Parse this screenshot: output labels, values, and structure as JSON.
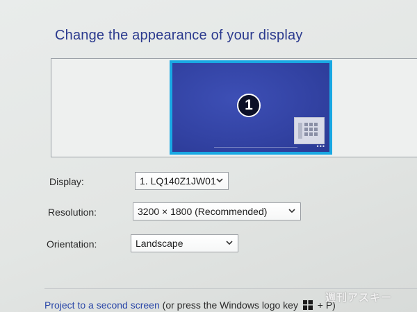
{
  "page": {
    "heading": "Change the appearance of your display"
  },
  "preview": {
    "monitor_number": "1",
    "accent_color": "#19a8e3",
    "screen_color": "#3343a4"
  },
  "settings": {
    "display": {
      "label": "Display:",
      "value": "1. LQ140Z1JW01"
    },
    "resolution": {
      "label": "Resolution:",
      "value": "3200 × 1800 (Recommended)"
    },
    "orientation": {
      "label": "Orientation:",
      "value": "Landscape"
    }
  },
  "footer": {
    "link_text": "Project to a second screen",
    "text_before_logo": " (or press the Windows logo key ",
    "text_after_logo": " + P)"
  },
  "watermark": {
    "text": "週刊アスキー"
  },
  "icons": {
    "dropdown": "chevron-down-icon",
    "windows": "windows-logo-icon",
    "start_tile": "start-screen-tiles-icon"
  }
}
